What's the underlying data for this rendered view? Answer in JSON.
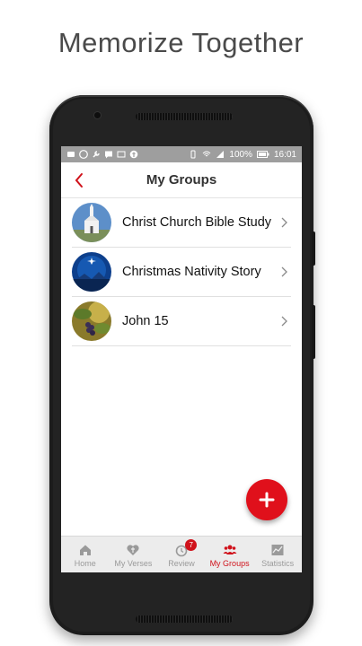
{
  "headline": "Memorize Together",
  "status": {
    "battery": "100%",
    "time": "16:01"
  },
  "appbar": {
    "title": "My Groups"
  },
  "groups": [
    {
      "label": "Christ Church Bible Study"
    },
    {
      "label": "Christmas Nativity Story"
    },
    {
      "label": "John 15"
    }
  ],
  "nav": [
    {
      "label": "Home",
      "icon": "home-icon"
    },
    {
      "label": "My Verses",
      "icon": "heart-icon"
    },
    {
      "label": "Review",
      "icon": "alarm-clock-icon",
      "badge": "7"
    },
    {
      "label": "My Groups",
      "icon": "people-icon"
    },
    {
      "label": "Statistics",
      "icon": "chart-icon"
    }
  ],
  "colors": {
    "accent": "#d0121b",
    "fab": "#e0101b",
    "statusbar": "#9e9e9e"
  }
}
